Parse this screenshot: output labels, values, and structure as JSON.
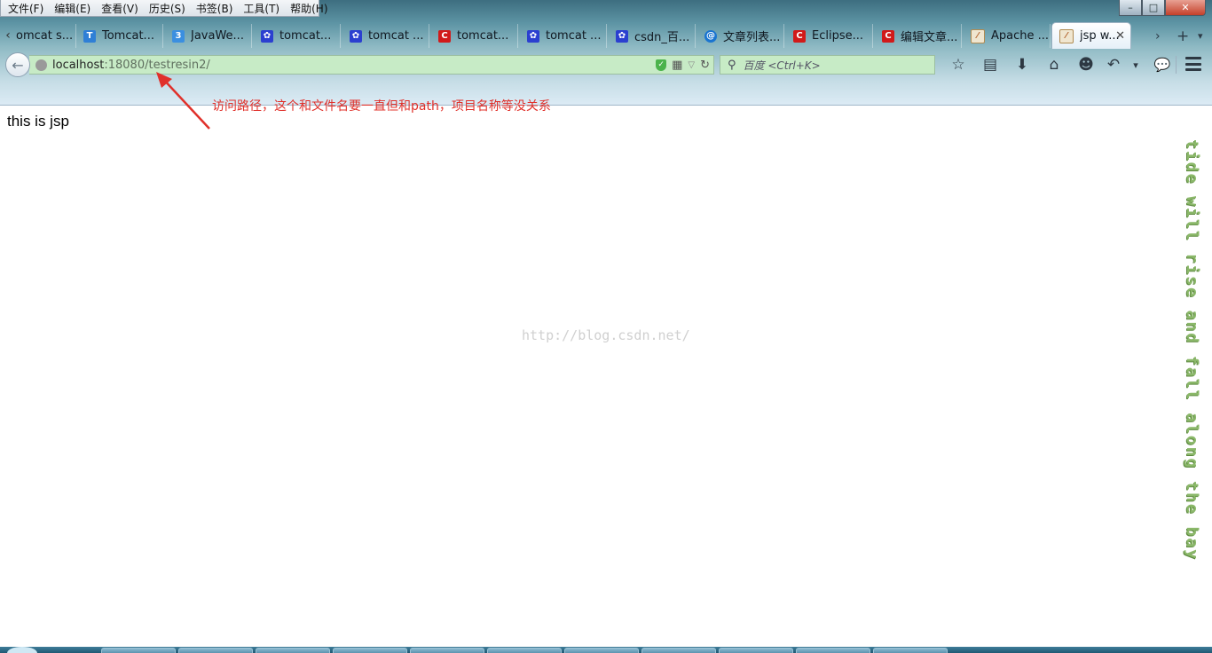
{
  "menubar": {
    "items": [
      "文件(F)",
      "编辑(E)",
      "查看(V)",
      "历史(S)",
      "书签(B)",
      "工具(T)",
      "帮助(H)"
    ]
  },
  "window_controls": {
    "minimize": "–",
    "maximize": "□",
    "close": "✕"
  },
  "tabs": [
    {
      "label": "omcat s...",
      "icon": "none",
      "color": ""
    },
    {
      "label": "Tomcat...",
      "icon": "T",
      "color": "#2f7fd6"
    },
    {
      "label": "JavaWe...",
      "icon": "3",
      "color": "#3b8fe0"
    },
    {
      "label": "tomcat...",
      "icon": "paw",
      "color": "#2b3fd0"
    },
    {
      "label": "tomcat ...",
      "icon": "paw",
      "color": "#2b3fd0"
    },
    {
      "label": "tomcat...",
      "icon": "C",
      "color": "#d11a1a"
    },
    {
      "label": "tomcat ...",
      "icon": "paw",
      "color": "#2b3fd0"
    },
    {
      "label": "csdn_百...",
      "icon": "paw",
      "color": "#2b3fd0"
    },
    {
      "label": "文章列表...",
      "icon": "@",
      "color": "#1a74d0"
    },
    {
      "label": "Eclipse...",
      "icon": "C",
      "color": "#d11a1a"
    },
    {
      "label": "编辑文章...",
      "icon": "C",
      "color": "#d11a1a"
    },
    {
      "label": "Apache ...",
      "icon": "feather",
      "color": "#c28a3a"
    },
    {
      "label": "jsp w...",
      "icon": "feather",
      "color": "#c28a3a",
      "active": true,
      "close": "✕"
    }
  ],
  "tab_controls": {
    "scroll_left": "‹",
    "scroll_right": "›",
    "new_tab": "+",
    "list_all": "▾"
  },
  "urlbar": {
    "host": "localhost",
    "rest": ":18080/testresin2/",
    "reload": "C"
  },
  "searchbar": {
    "placeholder": "百度 <Ctrl+K>"
  },
  "toolbar": {
    "icons": [
      "star-icon",
      "reading-list-icon",
      "download-icon",
      "home-icon",
      "chat-icon",
      "undo-icon",
      "dropdown-icon",
      "comment-icon"
    ],
    "glyphs": [
      "☆",
      "▤",
      "⬇",
      "⌂",
      "☻",
      "↶",
      "▾",
      "💬"
    ]
  },
  "page": {
    "body_text": "this is jsp",
    "annotation": "访问路径，这个和文件名要一直但和path，项目名称等没关系",
    "watermark": "http://blog.csdn.net/",
    "vertical_text": "tide will rise and fall along the bay",
    "annotation_color": "#e0302a"
  },
  "colors": {
    "urlbar_bg": "#c7ebc6",
    "vertical_text": "#8bb86a"
  }
}
